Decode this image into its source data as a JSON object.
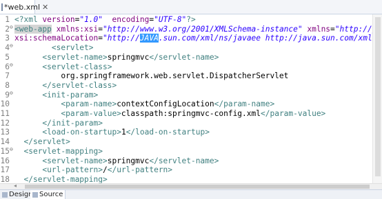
{
  "tab": {
    "title": "*web.xml",
    "close": "✕"
  },
  "lines": [
    {
      "n": "1",
      "fold": "",
      "segs": [
        [
          "pi",
          "<?xml "
        ],
        [
          "attr",
          "version"
        ],
        [
          "",
          "="
        ],
        [
          "val",
          "\"1.0\""
        ],
        [
          "",
          "  "
        ],
        [
          "attr",
          "encoding"
        ],
        [
          "",
          "="
        ],
        [
          "val",
          "\"UTF-8\""
        ],
        [
          "pi",
          "?>"
        ]
      ]
    },
    {
      "n": "2",
      "fold": "⊖",
      "segs": [
        [
          "tag hl",
          "<web-app"
        ],
        [
          "",
          ""
        ],
        [
          "attr",
          " xmlns:xsi"
        ],
        [
          "",
          "="
        ],
        [
          "val",
          "\"http://www.w3.org/2001/XMLSchema-instance\""
        ],
        [
          "",
          ""
        ],
        [
          "attr",
          " xmlns"
        ],
        [
          "",
          "="
        ],
        [
          "val",
          "\"http://java."
        ]
      ]
    },
    {
      "n": "3",
      "fold": "",
      "segs": [
        [
          "attr",
          "xsi:schemaLocation"
        ],
        [
          "",
          "="
        ],
        [
          "val",
          "\"http://"
        ],
        [
          "val sel",
          "JAVA"
        ],
        [
          "val",
          ".sun.com/xml/ns/javaee http://java.sun.com/xml/ns/j"
        ]
      ]
    },
    {
      "n": "4",
      "fold": "⊖",
      "segs": [
        [
          "",
          "        "
        ],
        [
          "tag",
          "<servlet>"
        ]
      ]
    },
    {
      "n": "5",
      "fold": "",
      "segs": [
        [
          "",
          "      "
        ],
        [
          "tag",
          "<servlet-name>"
        ],
        [
          "",
          "springmvc"
        ],
        [
          "tag",
          "</servlet-name>"
        ]
      ]
    },
    {
      "n": "6",
      "fold": "⊖",
      "segs": [
        [
          "",
          "      "
        ],
        [
          "tag",
          "<servlet-class>"
        ]
      ]
    },
    {
      "n": "7",
      "fold": "",
      "segs": [
        [
          "",
          "          org.springframework.web.servlet.DispatcherServlet"
        ]
      ]
    },
    {
      "n": "8",
      "fold": "",
      "segs": [
        [
          "",
          "      "
        ],
        [
          "tag",
          "</servlet-class>"
        ]
      ]
    },
    {
      "n": "9",
      "fold": "⊖",
      "segs": [
        [
          "",
          "      "
        ],
        [
          "tag",
          "<init-param>"
        ]
      ]
    },
    {
      "n": "10",
      "fold": "",
      "segs": [
        [
          "",
          "          "
        ],
        [
          "tag",
          "<param-name>"
        ],
        [
          "",
          "contextConfigLocation"
        ],
        [
          "tag",
          "</param-name>"
        ]
      ]
    },
    {
      "n": "11",
      "fold": "",
      "segs": [
        [
          "",
          "          "
        ],
        [
          "tag",
          "<param-value>"
        ],
        [
          "",
          "classpath:springmvc-config.xml"
        ],
        [
          "tag",
          "</param-value>"
        ]
      ]
    },
    {
      "n": "12",
      "fold": "",
      "segs": [
        [
          "",
          "      "
        ],
        [
          "tag",
          "</init-param>"
        ]
      ]
    },
    {
      "n": "13",
      "fold": "",
      "segs": [
        [
          "",
          "      "
        ],
        [
          "tag",
          "<load-on-startup>"
        ],
        [
          "",
          "1"
        ],
        [
          "tag",
          "</load-on-startup>"
        ]
      ]
    },
    {
      "n": "14",
      "fold": "",
      "segs": [
        [
          "",
          "  "
        ],
        [
          "tag",
          "</servlet>"
        ]
      ]
    },
    {
      "n": "15",
      "fold": "⊖",
      "segs": [
        [
          "",
          "  "
        ],
        [
          "tag",
          "<servlet-mapping>"
        ]
      ]
    },
    {
      "n": "16",
      "fold": "",
      "segs": [
        [
          "",
          "      "
        ],
        [
          "tag",
          "<servlet-name>"
        ],
        [
          "",
          "springmvc"
        ],
        [
          "tag",
          "</servlet-name>"
        ]
      ]
    },
    {
      "n": "17",
      "fold": "",
      "segs": [
        [
          "",
          "      "
        ],
        [
          "tag",
          "<url-pattern>"
        ],
        [
          "",
          "/"
        ],
        [
          "tag",
          "</url-pattern>"
        ]
      ]
    },
    {
      "n": "18",
      "fold": "",
      "segs": [
        [
          "",
          "  "
        ],
        [
          "tag",
          "</servlet-mapping>"
        ]
      ]
    }
  ],
  "bottom_tabs": [
    {
      "label": "Design",
      "active": false
    },
    {
      "label": "Source",
      "active": true
    }
  ]
}
